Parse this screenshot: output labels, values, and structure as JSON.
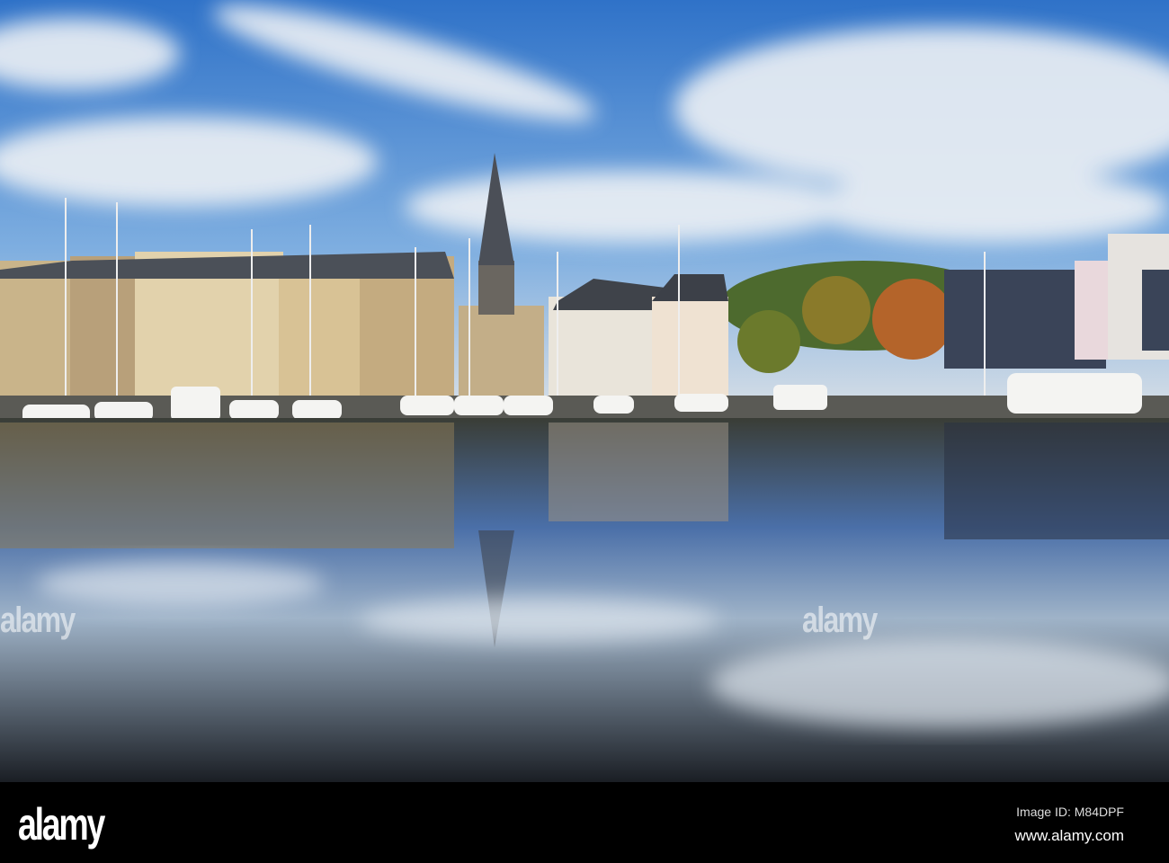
{
  "watermark": {
    "text": "alamy"
  },
  "footer": {
    "logo": "alamy",
    "image_id": "Image ID: M84DPF",
    "website": "www.alamy.com"
  },
  "colors": {
    "sky": "#3a7fd0",
    "water": "#1b2430",
    "bar": "#000000"
  }
}
